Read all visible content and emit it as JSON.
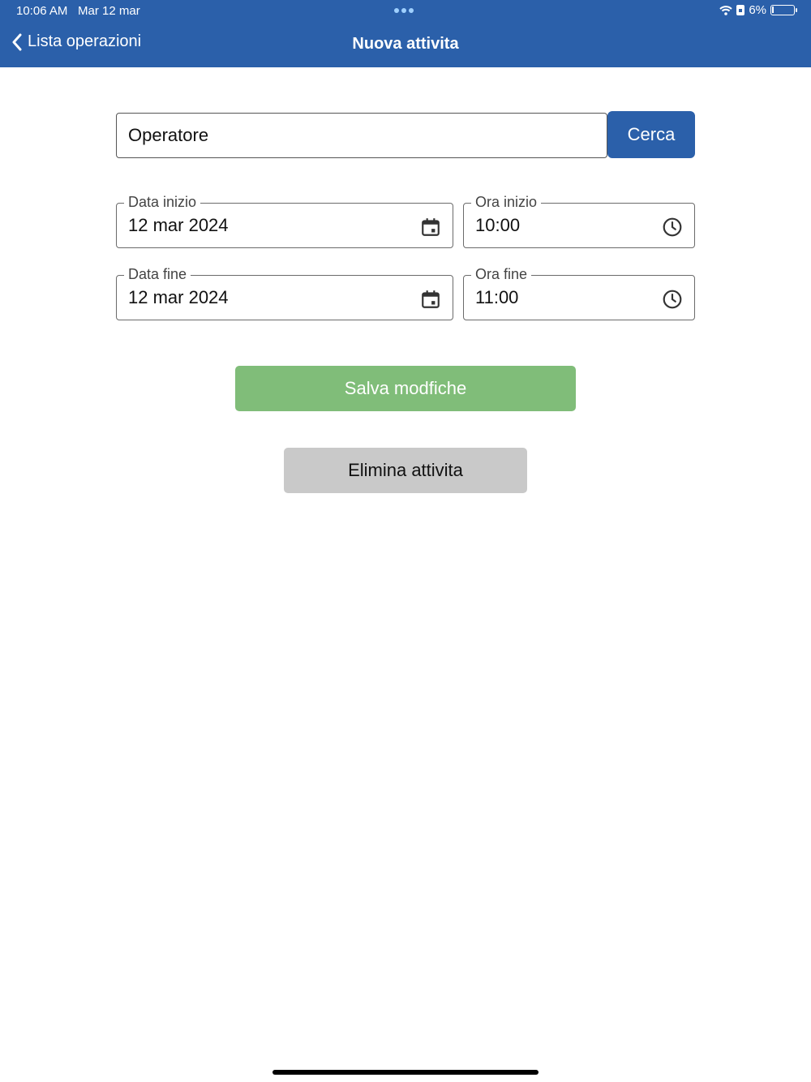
{
  "status_bar": {
    "time": "10:06 AM",
    "date": "Mar 12 mar",
    "battery": "6%",
    "battery_level": 0.06
  },
  "nav": {
    "back_label": "Lista operazioni",
    "title": "Nuova attivita"
  },
  "search": {
    "placeholder": "Operatore",
    "button_label": "Cerca"
  },
  "fields": {
    "start_date": {
      "label": "Data inizio",
      "value": "12 mar 2024",
      "icon": "calendar-icon"
    },
    "start_time": {
      "label": "Ora inizio",
      "value": "10:00",
      "icon": "clock-icon"
    },
    "end_date": {
      "label": "Data fine",
      "value": "12 mar 2024",
      "icon": "calendar-icon"
    },
    "end_time": {
      "label": "Ora fine",
      "value": "11:00",
      "icon": "clock-icon"
    }
  },
  "actions": {
    "save_label": "Salva modfiche",
    "delete_label": "Elimina attivita"
  },
  "colors": {
    "primary": "#2b60aa",
    "save": "#80bd79",
    "delete": "#c9c9c9"
  }
}
